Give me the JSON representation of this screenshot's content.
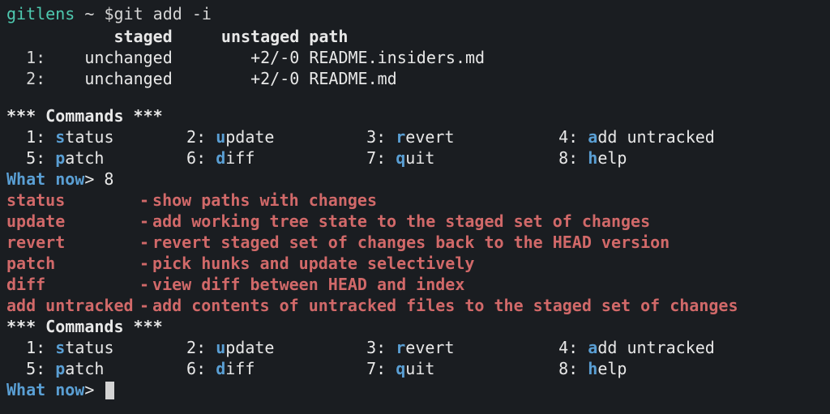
{
  "prompt": {
    "dir": "gitlens",
    "tilde": "~",
    "dollar": "$",
    "command": "git add -i"
  },
  "table": {
    "header_staged": "staged",
    "header_unstaged": "unstaged",
    "header_path": "path",
    "rows": [
      {
        "index": "1:",
        "staged": "unchanged",
        "unstaged": "+2/-0",
        "path": "README.insiders.md"
      },
      {
        "index": "2:",
        "staged": "unchanged",
        "unstaged": "+2/-0",
        "path": "README.md"
      }
    ]
  },
  "commands_header": "*** Commands ***",
  "commands": [
    {
      "num": "1:",
      "hotkey": "s",
      "rest": "tatus"
    },
    {
      "num": "2:",
      "hotkey": "u",
      "rest": "pdate"
    },
    {
      "num": "3:",
      "hotkey": "r",
      "rest": "evert"
    },
    {
      "num": "4:",
      "hotkey": "a",
      "rest": "dd untracked"
    },
    {
      "num": "5:",
      "hotkey": "p",
      "rest": "atch"
    },
    {
      "num": "6:",
      "hotkey": "d",
      "rest": "iff"
    },
    {
      "num": "7:",
      "hotkey": "q",
      "rest": "uit"
    },
    {
      "num": "8:",
      "hotkey": "h",
      "rest": "elp"
    }
  ],
  "what_now_prompt": "What now",
  "what_now_arrow": ">",
  "first_input": "8",
  "help": [
    {
      "name": "status",
      "desc": "show paths with changes"
    },
    {
      "name": "update",
      "desc": "add working tree state to the staged set of changes"
    },
    {
      "name": "revert",
      "desc": "revert staged set of changes back to the HEAD version"
    },
    {
      "name": "patch",
      "desc": "pick hunks and update selectively"
    },
    {
      "name": "diff",
      "desc": "view diff between HEAD and index"
    },
    {
      "name": "add untracked",
      "desc": "add contents of untracked files to the staged set of changes"
    }
  ],
  "help_sep": "-"
}
